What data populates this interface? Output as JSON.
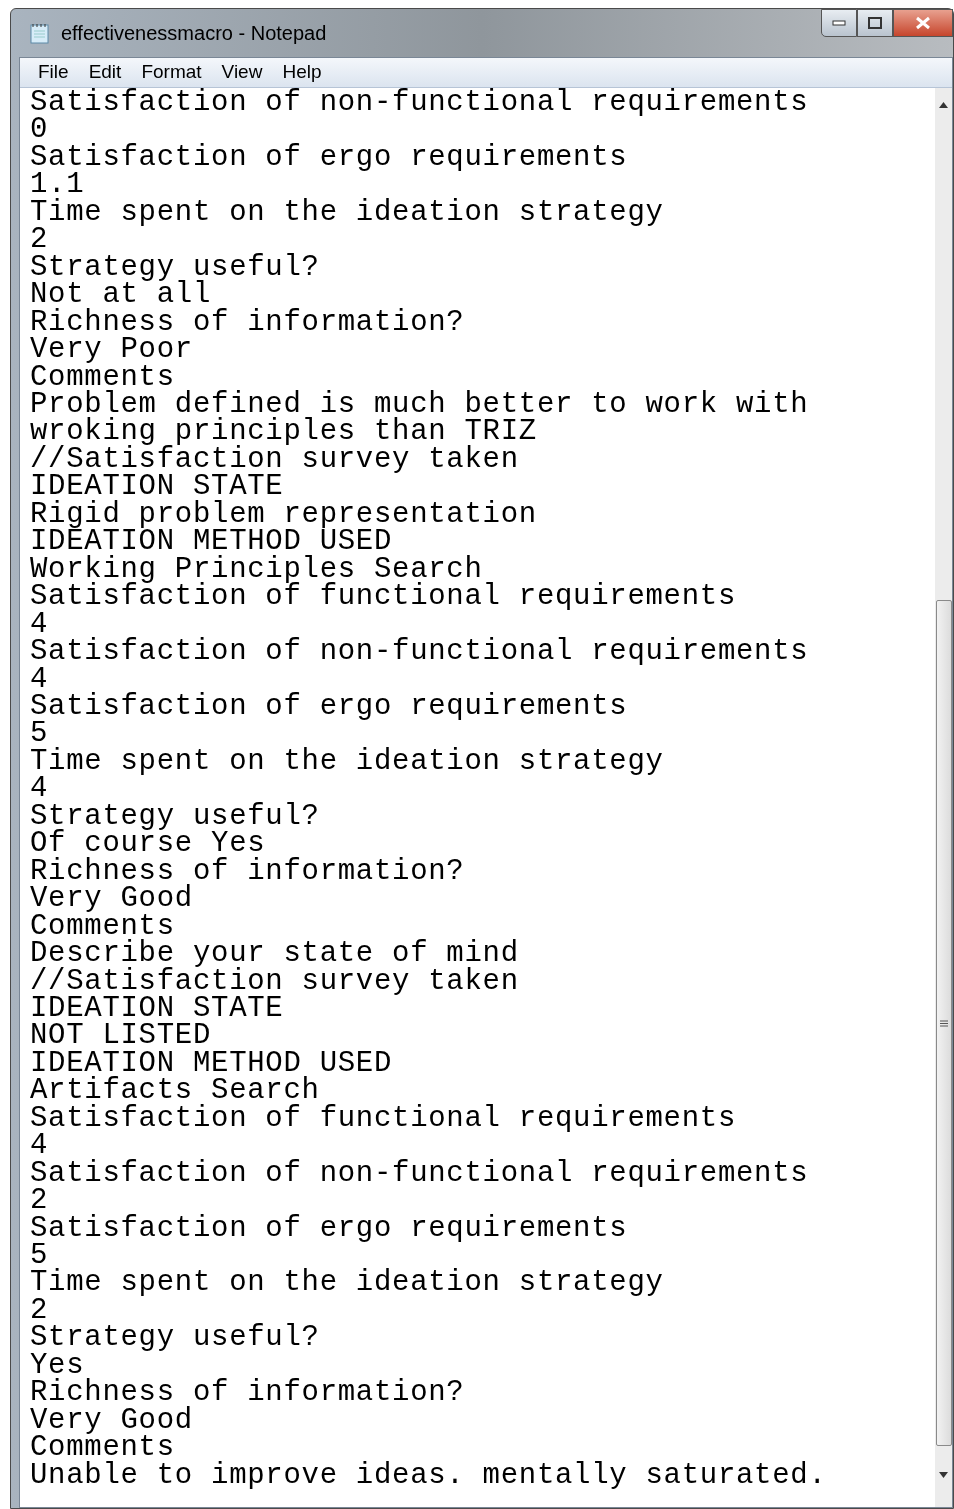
{
  "window": {
    "title": "effectivenessmacro - Notepad"
  },
  "menu": [
    "File",
    "Edit",
    "Format",
    "View",
    "Help"
  ],
  "lines": [
    "Satisfaction of non-functional requirements",
    "0",
    "Satisfaction of ergo requirements",
    "1.1",
    "Time spent on the ideation strategy",
    "2",
    "Strategy useful?",
    "Not at all",
    "Richness of information?",
    "Very Poor",
    "Comments",
    "Problem defined is much better to work with",
    "wroking principles than TRIZ",
    "//Satisfaction survey taken",
    "IDEATION STATE",
    "Rigid problem representation",
    "IDEATION METHOD USED",
    "Working Principles Search",
    "Satisfaction of functional requirements",
    "4",
    "Satisfaction of non-functional requirements",
    "4",
    "Satisfaction of ergo requirements",
    "5",
    "Time spent on the ideation strategy",
    "4",
    "Strategy useful?",
    "Of course Yes",
    "Richness of information?",
    "Very Good",
    "Comments",
    "Describe your state of mind",
    "//Satisfaction survey taken",
    "IDEATION STATE",
    "NOT LISTED",
    "IDEATION METHOD USED",
    "Artifacts Search",
    "Satisfaction of functional requirements",
    "4",
    "Satisfaction of non-functional requirements",
    "2",
    "Satisfaction of ergo requirements",
    "5",
    "Time spent on the ideation strategy",
    "2",
    "Strategy useful?",
    "Yes",
    "Richness of information?",
    "Very Good",
    "Comments",
    "Unable to improve ideas. mentally saturated."
  ]
}
